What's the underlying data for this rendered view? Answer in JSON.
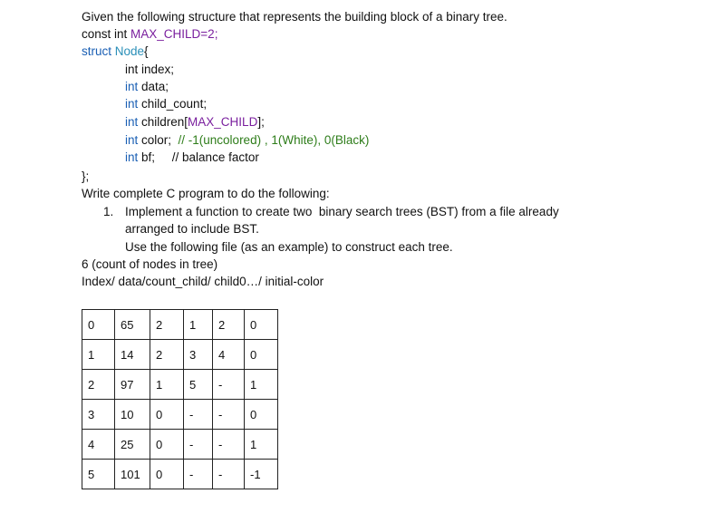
{
  "intro": "Given the following structure that represents the building block of a binary tree.",
  "const_line": {
    "prefix": "const int ",
    "name": "MAX_CHILD=2;"
  },
  "struct_line": {
    "keyword": "struct ",
    "name": "Node",
    "brace": "{"
  },
  "fields": [
    {
      "type": "int",
      "rest": " index;",
      "comment": ""
    },
    {
      "type": "int",
      "rest": " data;",
      "comment": ""
    },
    {
      "type": "int",
      "rest": " child_count;",
      "comment": ""
    },
    {
      "type": "int",
      "rest": " children[",
      "macro": "MAX_CHILD",
      "after": "];",
      "comment": ""
    },
    {
      "type": "int",
      "rest": " color;  ",
      "comment": "// -1(uncolored) , 1(White), 0(Black)"
    },
    {
      "type": "int",
      "rest": " bf;     ",
      "comment": "// balance factor"
    }
  ],
  "struct_close": "};",
  "task_heading": "Write complete C program to do the following:",
  "task_item": {
    "number": "1.",
    "text_line1": "Implement a function to create two  binary search trees (BST) from a file already",
    "text_line2": "arranged to include BST.",
    "text_line3": "Use the following file (as an example) to construct each tree."
  },
  "count_line": "6 (count of nodes in tree)",
  "format_line": "Index/ data/count_child/ child0…/ initial-color",
  "table": {
    "rows": [
      [
        "0",
        "65",
        "2",
        "1",
        "2",
        "0"
      ],
      [
        "1",
        "14",
        "2",
        "3",
        "4",
        "0"
      ],
      [
        "2",
        "97",
        "1",
        "5",
        "-",
        "1"
      ],
      [
        "3",
        "10",
        "0",
        "-",
        "-",
        "0"
      ],
      [
        "4",
        "25",
        "0",
        "-",
        "-",
        "1"
      ],
      [
        "5",
        "101",
        "0",
        "-",
        "-",
        "-1"
      ]
    ]
  }
}
